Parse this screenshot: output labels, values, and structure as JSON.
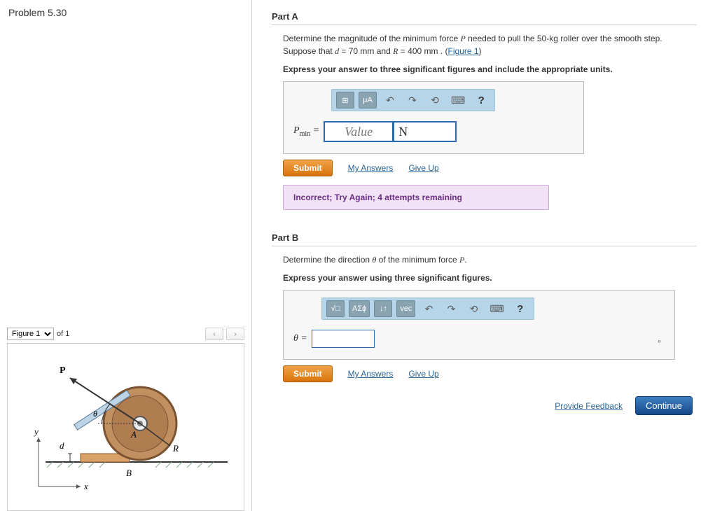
{
  "problem_title": "Problem 5.30",
  "figure": {
    "select_label": "Figure 1",
    "of_text": "of 1",
    "prev": "‹",
    "next": "›"
  },
  "partA": {
    "heading": "Part A",
    "prompt_pre": "Determine the magnitude of the minimum force ",
    "prompt_var": "P",
    "prompt_mid": " needed to pull the 50-kg roller over the smooth step. Suppose that ",
    "d_label": "d",
    "d_val": " = 70  mm",
    "and_text": " and ",
    "R_label": "R",
    "R_val": " = 400  mm . (",
    "fig_link": "Figure 1",
    "close_paren": ")",
    "instruct": "Express your answer to three significant figures and include the appropriate units.",
    "answer_label_base": "P",
    "answer_label_sub": "min",
    "equals": " = ",
    "value_placeholder": "Value",
    "unit_value": "N",
    "toolbar": {
      "t1": "⊞",
      "t2": "μA",
      "undo": "↶",
      "redo": "↷",
      "reset": "⟲",
      "kbd": "⌨",
      "help": "?"
    },
    "submit": "Submit",
    "my_answers": "My Answers",
    "give_up": "Give Up",
    "feedback": "Incorrect; Try Again; 4 attempts remaining"
  },
  "partB": {
    "heading": "Part B",
    "prompt_pre": "Determine the direction ",
    "theta": "θ",
    "prompt_mid": " of the minimum force ",
    "P_var": "P",
    "prompt_end": ".",
    "instruct": "Express your answer using three significant figures.",
    "answer_label": "θ = ",
    "deg": "∘",
    "toolbar": {
      "t1": "√□",
      "t2": "ΑΣϕ",
      "t3": "↓↑",
      "t4": "vec",
      "undo": "↶",
      "redo": "↷",
      "reset": "⟲",
      "kbd": "⌨",
      "help": "?"
    },
    "submit": "Submit",
    "my_answers": "My Answers",
    "give_up": "Give Up"
  },
  "footer": {
    "provide_feedback": "Provide Feedback",
    "continue": "Continue"
  },
  "diagram": {
    "P": "P",
    "theta": "θ",
    "d": "d",
    "A": "A",
    "R": "R",
    "B": "B",
    "x": "x",
    "y": "y"
  }
}
